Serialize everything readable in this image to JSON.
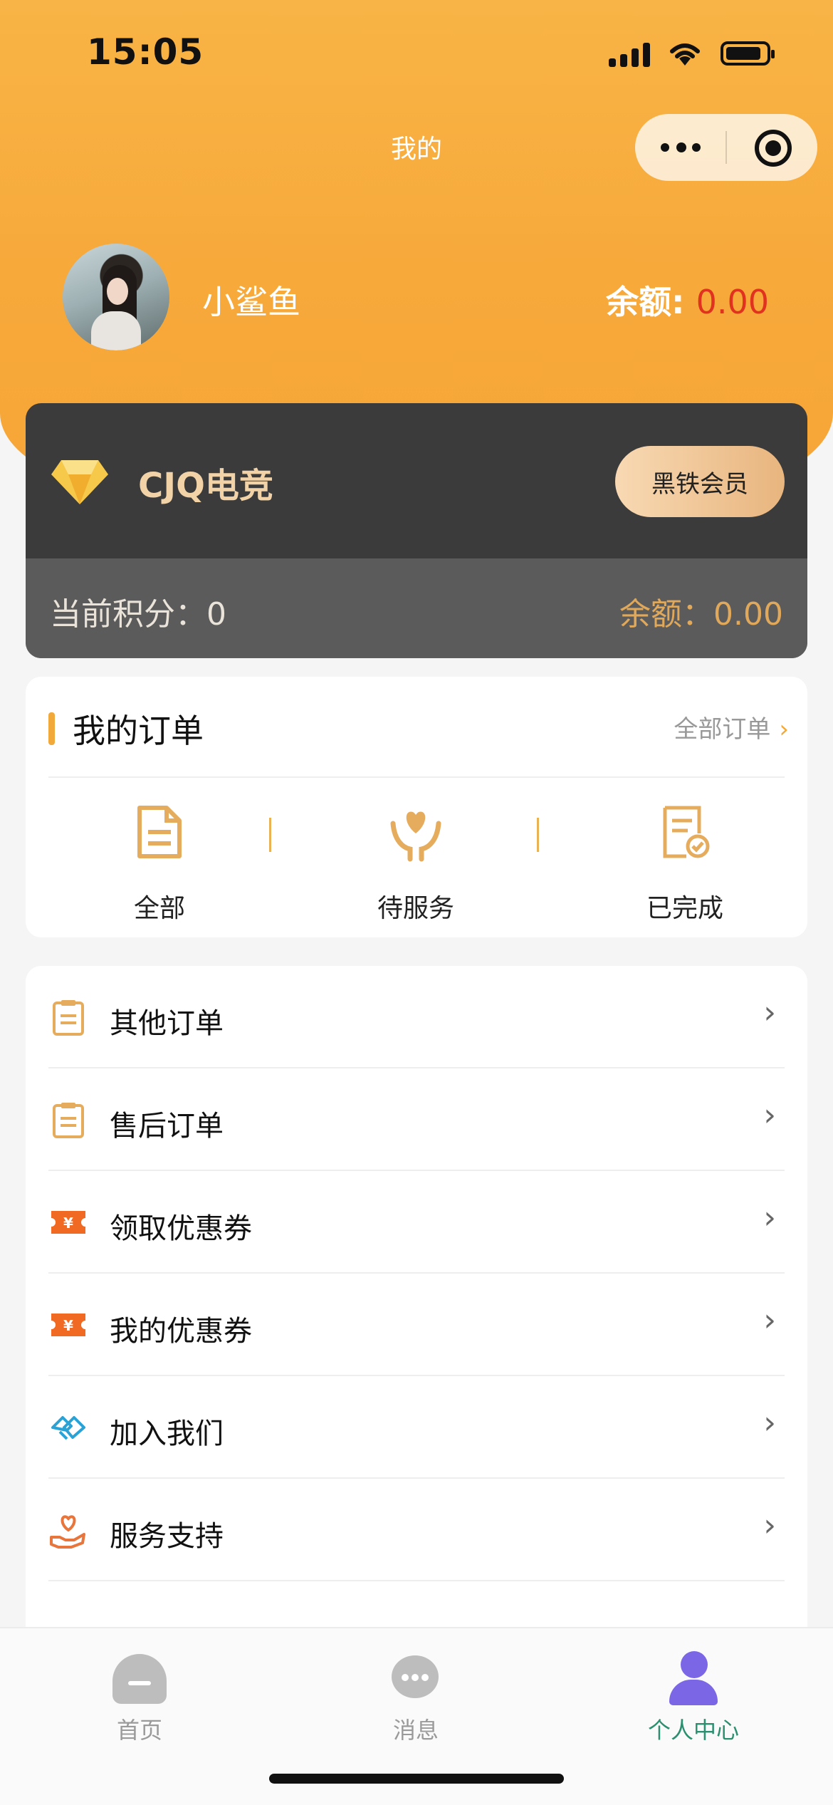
{
  "status": {
    "time": "15:05"
  },
  "nav": {
    "title": "我的"
  },
  "profile": {
    "username": "小鲨鱼",
    "balance_label": "余额:",
    "balance_value": "0.00"
  },
  "member_card": {
    "brand": "CJQ电竞",
    "level_button": "黑铁会员",
    "points_label": "当前积分：0",
    "balance_label": "余额：0.00"
  },
  "orders": {
    "title": "我的订单",
    "all_label": "全部订单",
    "items": [
      {
        "label": "全部",
        "icon": "document-icon"
      },
      {
        "label": "待服务",
        "icon": "heart-hands-icon"
      },
      {
        "label": "已完成",
        "icon": "document-check-icon"
      }
    ]
  },
  "menu": {
    "items": [
      {
        "label": "其他订单",
        "icon": "clipboard-icon"
      },
      {
        "label": "售后订单",
        "icon": "clipboard-icon"
      },
      {
        "label": "领取优惠券",
        "icon": "coupon-icon"
      },
      {
        "label": "我的优惠券",
        "icon": "coupon-icon"
      },
      {
        "label": "加入我们",
        "icon": "handshake-icon"
      },
      {
        "label": "服务支持",
        "icon": "heart-hand-icon"
      }
    ]
  },
  "tabbar": {
    "items": [
      {
        "label": "首页",
        "icon": "home-icon"
      },
      {
        "label": "消息",
        "icon": "message-icon"
      },
      {
        "label": "个人中心",
        "icon": "user-icon"
      }
    ]
  },
  "colors": {
    "accent": "#f6a637",
    "balance_red": "#e0321e",
    "active_tab": "#2c8f6f"
  }
}
